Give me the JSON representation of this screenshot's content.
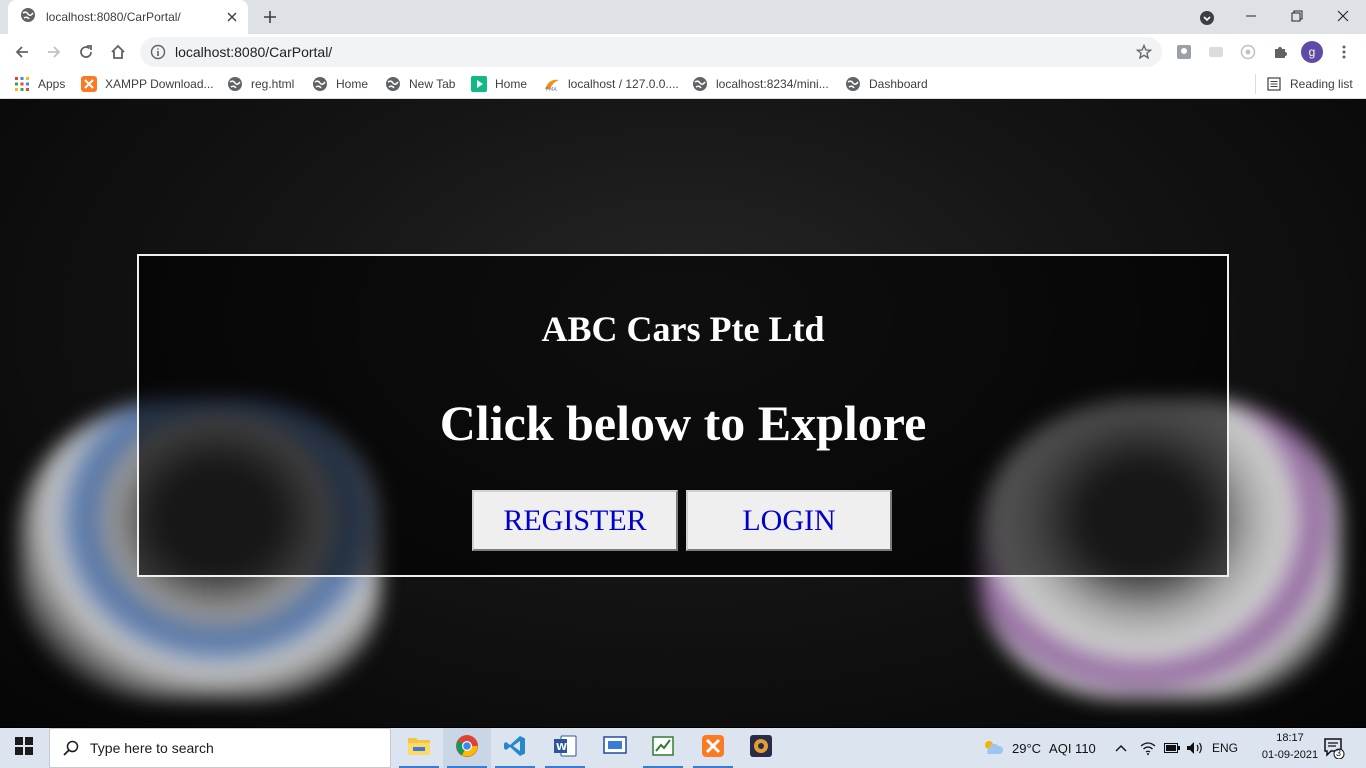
{
  "browser": {
    "tab_title": "localhost:8080/CarPortal/",
    "url": "localhost:8080/CarPortal/",
    "profile_initial": "g"
  },
  "bookmarks": [
    {
      "label": "Apps",
      "icon": "apps-grid-icon"
    },
    {
      "label": "XAMPP Download...",
      "icon": "xampp-icon"
    },
    {
      "label": "reg.html",
      "icon": "globe-icon"
    },
    {
      "label": "Home",
      "icon": "globe-icon"
    },
    {
      "label": "New Tab",
      "icon": "globe-icon"
    },
    {
      "label": "Home",
      "icon": "play-icon"
    },
    {
      "label": "localhost / 127.0.0....",
      "icon": "phpmyadmin-icon"
    },
    {
      "label": "localhost:8234/mini...",
      "icon": "globe-icon"
    },
    {
      "label": "Dashboard",
      "icon": "globe-icon"
    }
  ],
  "reading_list_label": "Reading list",
  "page": {
    "company": "ABC Cars Pte Ltd",
    "headline": "Click below to Explore",
    "register_label": "REGISTER",
    "login_label": "LOGIN"
  },
  "taskbar": {
    "search_placeholder": "Type here to search",
    "apps": [
      "file-explorer",
      "chrome",
      "vscode",
      "word",
      "screen-app",
      "task-app",
      "xampp",
      "game-app"
    ],
    "weather": "29°C",
    "aqi": "AQI 110",
    "language": "ENG",
    "time": "18:17",
    "date": "01-09-2021",
    "notification_count": "3"
  },
  "colors": {
    "link_blue": "#0000cd",
    "tab_strip": "#dee1e6",
    "taskbar": "#dbe4ef"
  }
}
